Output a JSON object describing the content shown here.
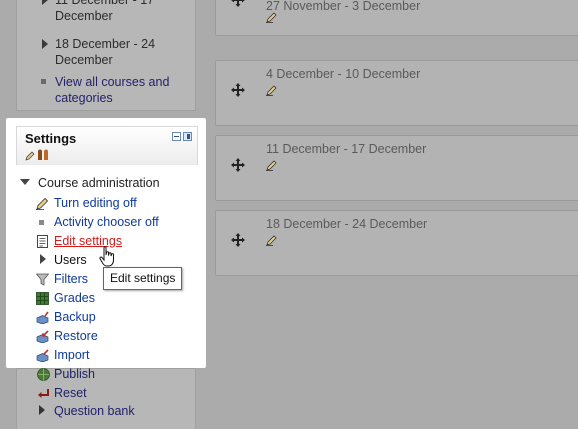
{
  "navigation": {
    "items": [
      {
        "label": "11 December - 17 December"
      },
      {
        "label": "18 December - 24 December"
      }
    ],
    "view_all_link": "View all courses and categories"
  },
  "course_sections": {
    "weeks": [
      {
        "title": "27 November - 3 December"
      },
      {
        "title": "4 December - 10 December"
      },
      {
        "title": "11 December - 17 December"
      },
      {
        "title": "18 December - 24 December"
      }
    ]
  },
  "settings": {
    "title": "Settings",
    "tree_root": "Course administration",
    "items": [
      {
        "label": "Turn editing off",
        "icon": "pencil-icon"
      },
      {
        "label": "Activity chooser off",
        "icon": "bullet-icon"
      },
      {
        "label": "Edit settings",
        "icon": "document-icon"
      },
      {
        "label": "Users",
        "icon": "expand-icon"
      },
      {
        "label": "Filters",
        "icon": "funnel-icon"
      },
      {
        "label": "Grades",
        "icon": "grades-table-icon"
      },
      {
        "label": "Backup",
        "icon": "backup-icon"
      },
      {
        "label": "Restore",
        "icon": "restore-icon"
      },
      {
        "label": "Import",
        "icon": "import-icon"
      },
      {
        "label": "Publish",
        "icon": "globe-icon"
      },
      {
        "label": "Reset",
        "icon": "reset-arrow-icon"
      },
      {
        "label": "Question bank",
        "icon": "expand-icon"
      }
    ]
  },
  "tooltip": {
    "text": "Edit settings"
  },
  "colors": {
    "overlay": "#ababab",
    "link": "#0f3a99",
    "active_link": "#d21d1d",
    "panel": "#ffffff"
  }
}
